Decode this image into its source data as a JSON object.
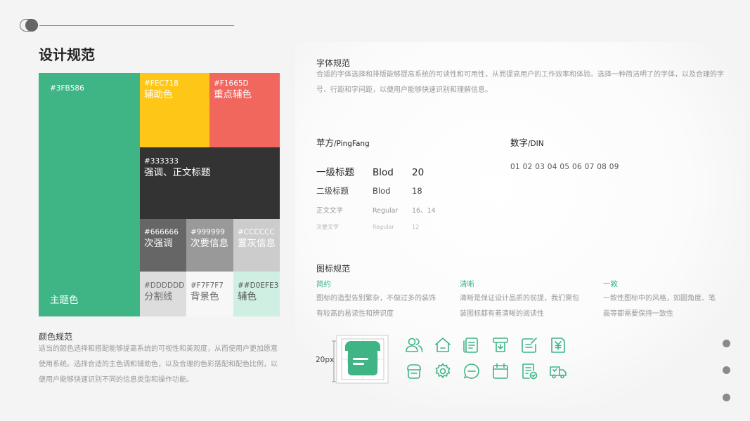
{
  "page": {
    "title": "设计规范"
  },
  "colors": {
    "primary": {
      "hex": "#3FB586",
      "label": "主题色"
    },
    "aux1": {
      "hex": "#FEC718",
      "label": "辅助色"
    },
    "aux2": {
      "hex": "#F1665D",
      "label": "重点辅色"
    },
    "dark": {
      "hex": "#333333",
      "label": "强调、正文标题"
    },
    "gray1": {
      "hex": "#666666",
      "label": "次强调"
    },
    "gray2": {
      "hex": "#999999",
      "label": "次要信息"
    },
    "gray3": {
      "hex": "#CCCCCC",
      "label": "置灰信息"
    },
    "divider": {
      "hex": "#DDDDDD",
      "label": "分割线"
    },
    "bg": {
      "hex": "#F7F7F7",
      "label": "背景色"
    },
    "aux3": {
      "hex": "##D0EFE3",
      "label": "辅色"
    }
  },
  "color_spec": {
    "title": "颜色规范",
    "lines": [
      "适当的颜色选择和搭配能够提高系统的可视性和美观度，从而使用户更加愿意",
      "使用系统。选择合适的主色调和辅助色，以及合理的色彩搭配和配色比例，以",
      "便用户能够快速识别不同的信息类型和操作功能。"
    ]
  },
  "font_spec": {
    "title": "字体规范",
    "lines": [
      "合适的字体选择和排版能够提高系统的可读性和可用性，从而提高用户的工作效率和体验。选择一种简洁明了的字体，以及合理的字",
      "号、行距和字间距，以便用户能够快速识别和理解信息。"
    ],
    "family_cn": {
      "main": "苹方",
      "sub": "/PingFang"
    },
    "family_num": {
      "main": "数字",
      "sub": "/DIN"
    },
    "digits": "01 02 03 04 05 06 07 08 09",
    "rows": [
      {
        "name": "一级标题",
        "weight": "Blod",
        "size": "20"
      },
      {
        "name": "二级标题",
        "weight": "Blod",
        "size": "18"
      },
      {
        "name": "正文文字",
        "weight": "Regular",
        "size": "16、14"
      },
      {
        "name": "次要文字",
        "weight": "Regular",
        "size": "12"
      }
    ]
  },
  "icon_spec": {
    "title": "图标规范",
    "columns": [
      {
        "title": "简约",
        "lines": [
          "图标的造型告别繁杂，不做过多的装饰",
          "有较高的易读性和辨识度"
        ]
      },
      {
        "title": "清晰",
        "lines": [
          "清晰是保证设计品质的前提，我们需包",
          "装图标都有着清晰的阅读性"
        ]
      },
      {
        "title": "一致",
        "lines": [
          "一致性图标中的风格，如圆角度、笔",
          "画等都需要保持一致性"
        ]
      }
    ],
    "size_label": "20px",
    "icons": [
      "users-icon",
      "home-icon",
      "document-icon",
      "print-icon",
      "edit-icon",
      "payment-icon",
      "shop-icon",
      "settings-icon",
      "chat-icon",
      "calendar-icon",
      "checklist-icon",
      "delivery-truck-icon"
    ],
    "accent": "#3FB586"
  }
}
